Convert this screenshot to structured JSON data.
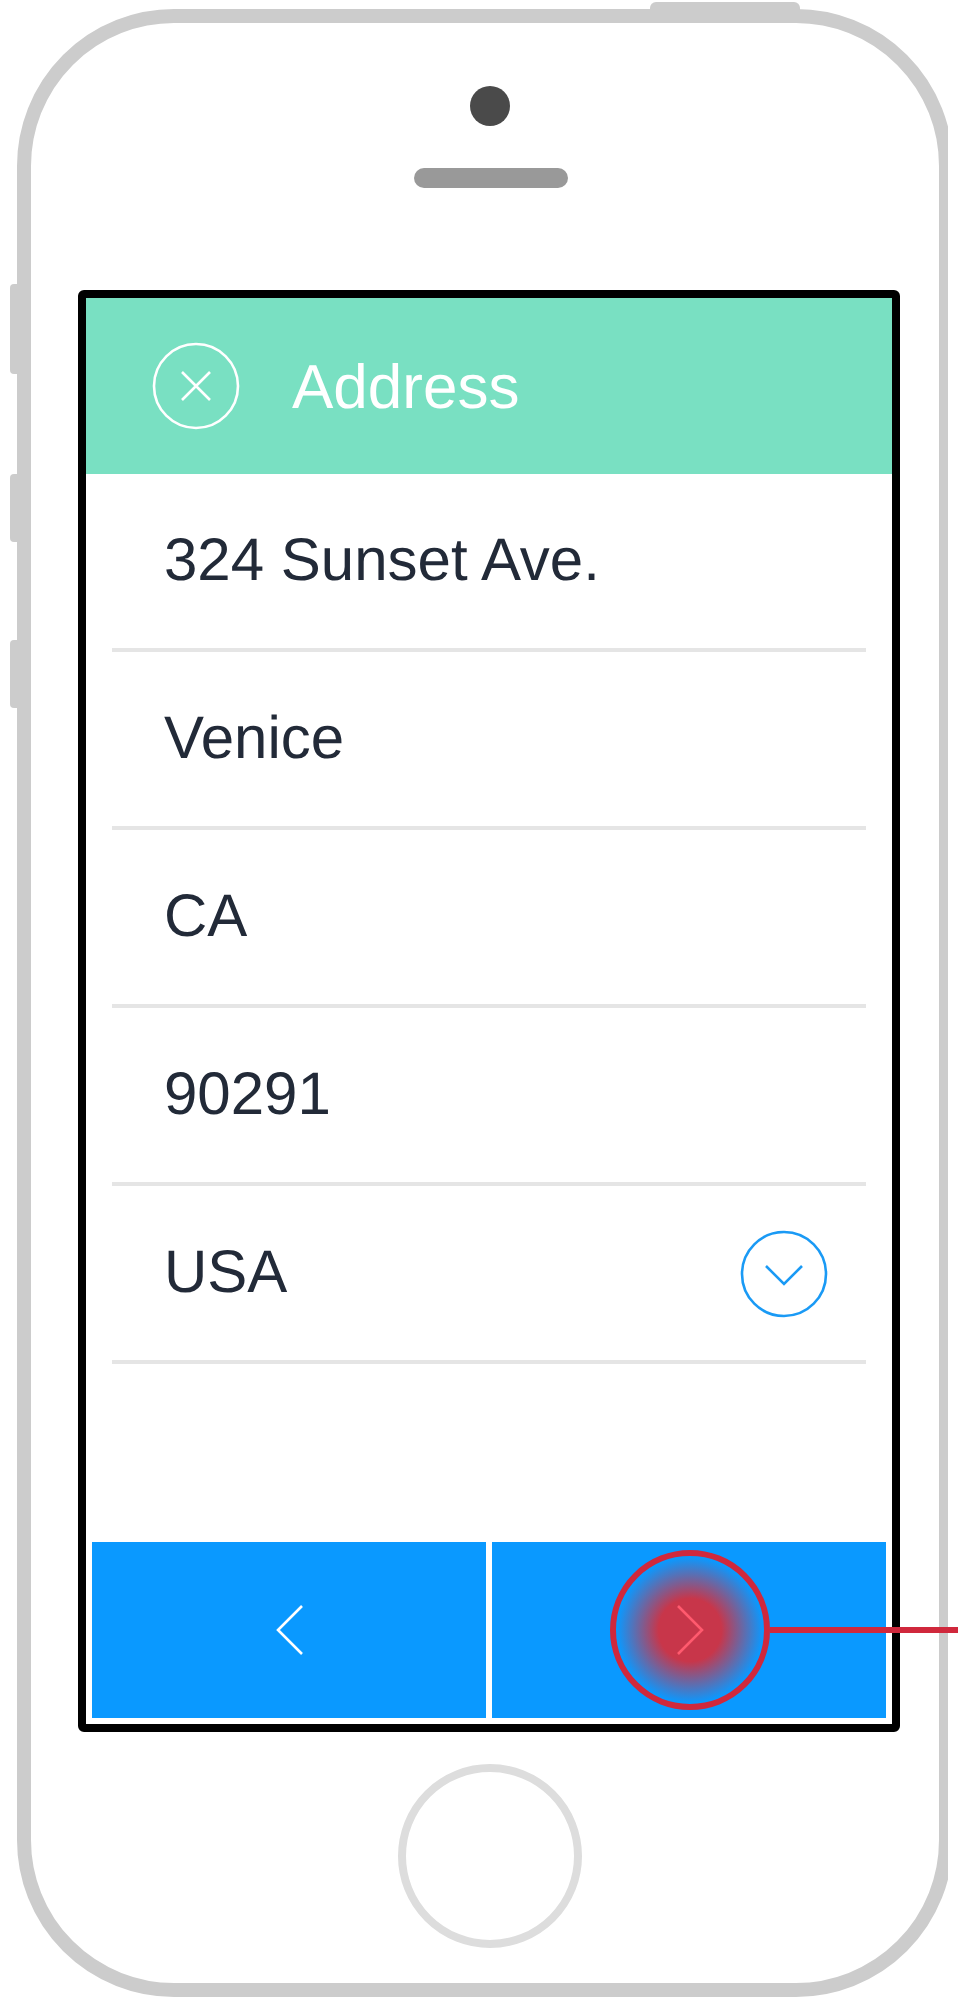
{
  "header": {
    "title": "Address"
  },
  "fields": [
    {
      "kind": "text",
      "value": "324 Sunset Ave."
    },
    {
      "kind": "text",
      "value": "Venice"
    },
    {
      "kind": "text",
      "value": "CA"
    },
    {
      "kind": "text",
      "value": "90291"
    },
    {
      "kind": "select",
      "value": "USA"
    }
  ],
  "nav_buttons": [
    {
      "kind": "back",
      "highlighted": false
    },
    {
      "kind": "next",
      "highlighted": true
    }
  ]
}
